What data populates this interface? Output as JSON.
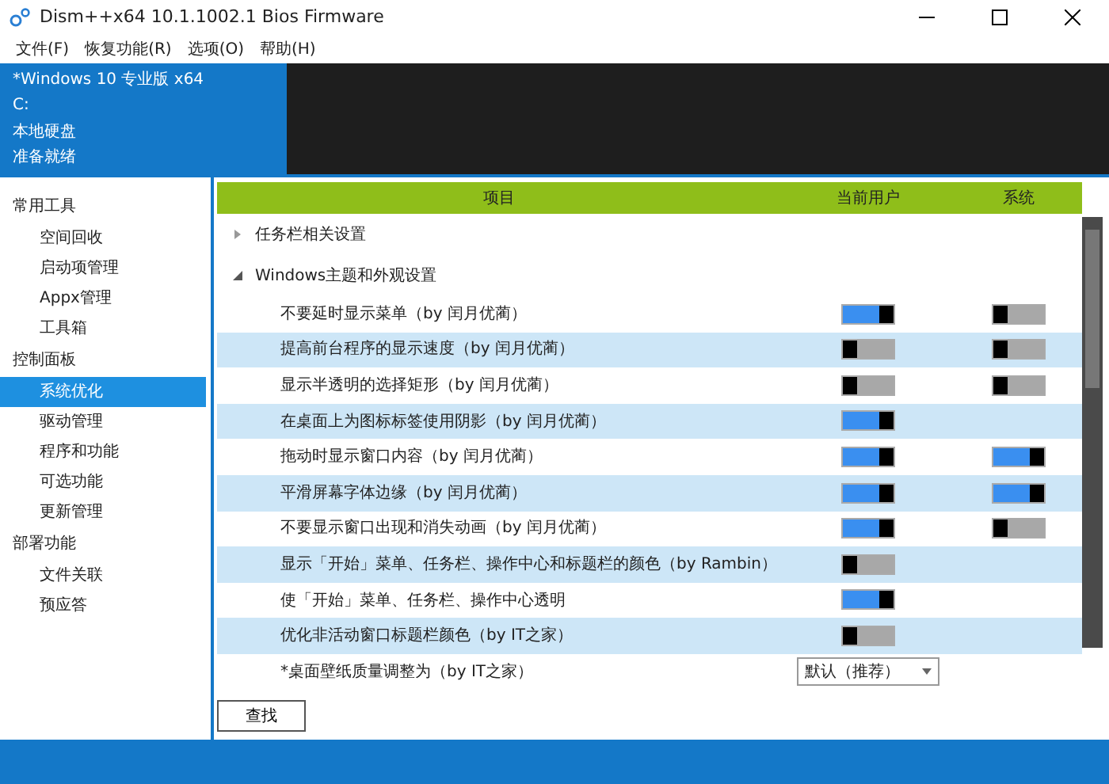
{
  "window": {
    "title": "Dism++x64 10.1.1002.1 Bios Firmware"
  },
  "menu": [
    "文件(F)",
    "恢复功能(R)",
    "选项(O)",
    "帮助(H)"
  ],
  "info": [
    "*Windows 10 专业版 x64",
    "C:",
    "本地硬盘",
    "准备就绪"
  ],
  "sidebar": [
    {
      "label": "常用工具",
      "children": [
        {
          "label": "空间回收",
          "selected": false
        },
        {
          "label": "启动项管理",
          "selected": false
        },
        {
          "label": "Appx管理",
          "selected": false
        },
        {
          "label": "工具箱",
          "selected": false
        }
      ]
    },
    {
      "label": "控制面板",
      "children": [
        {
          "label": "系统优化",
          "selected": true
        },
        {
          "label": "驱动管理",
          "selected": false
        },
        {
          "label": "程序和功能",
          "selected": false
        },
        {
          "label": "可选功能",
          "selected": false
        },
        {
          "label": "更新管理",
          "selected": false
        }
      ]
    },
    {
      "label": "部署功能",
      "children": [
        {
          "label": "文件关联",
          "selected": false
        },
        {
          "label": "预应答",
          "selected": false
        }
      ]
    }
  ],
  "table": {
    "columns": [
      "项目",
      "当前用户",
      "系统"
    ],
    "rows": [
      {
        "kind": "group",
        "label": "任务栏相关设置",
        "expanded": false
      },
      {
        "kind": "group",
        "label": "Windows主题和外观设置",
        "expanded": true
      },
      {
        "kind": "toggle",
        "label": "不要延时显示菜单（by 闰月优蔺）",
        "user": {
          "on": true
        },
        "system": {
          "on": false
        }
      },
      {
        "kind": "toggle",
        "label": "提高前台程序的显示速度（by 闰月优蔺）",
        "user": {
          "on": false
        },
        "system": {
          "on": false
        }
      },
      {
        "kind": "toggle",
        "label": "显示半透明的选择矩形（by 闰月优蔺）",
        "user": {
          "on": false
        },
        "system": {
          "on": false
        }
      },
      {
        "kind": "toggle",
        "label": "在桌面上为图标标签使用阴影（by 闰月优蔺）",
        "user": {
          "on": true
        }
      },
      {
        "kind": "toggle",
        "label": "拖动时显示窗口内容（by 闰月优蔺）",
        "user": {
          "on": true
        },
        "system": {
          "on": true
        }
      },
      {
        "kind": "toggle",
        "label": "平滑屏幕字体边缘（by 闰月优蔺）",
        "user": {
          "on": true
        },
        "system": {
          "on": true
        }
      },
      {
        "kind": "toggle",
        "label": "不要显示窗口出现和消失动画（by 闰月优蔺）",
        "user": {
          "on": true
        },
        "system": {
          "on": false
        }
      },
      {
        "kind": "toggle",
        "label": "显示「开始」菜单、任务栏、操作中心和标题栏的颜色（by Rambin）",
        "user": {
          "on": false
        }
      },
      {
        "kind": "toggle",
        "label": "使「开始」菜单、任务栏、操作中心透明",
        "user": {
          "on": true
        }
      },
      {
        "kind": "toggle",
        "label": "优化非活动窗口标题栏颜色（by IT之家）",
        "user": {
          "on": false
        }
      },
      {
        "kind": "select",
        "label": "*桌面壁纸质量调整为（by IT之家）",
        "value": "默认（推荐）"
      }
    ]
  },
  "find_button": "查找"
}
